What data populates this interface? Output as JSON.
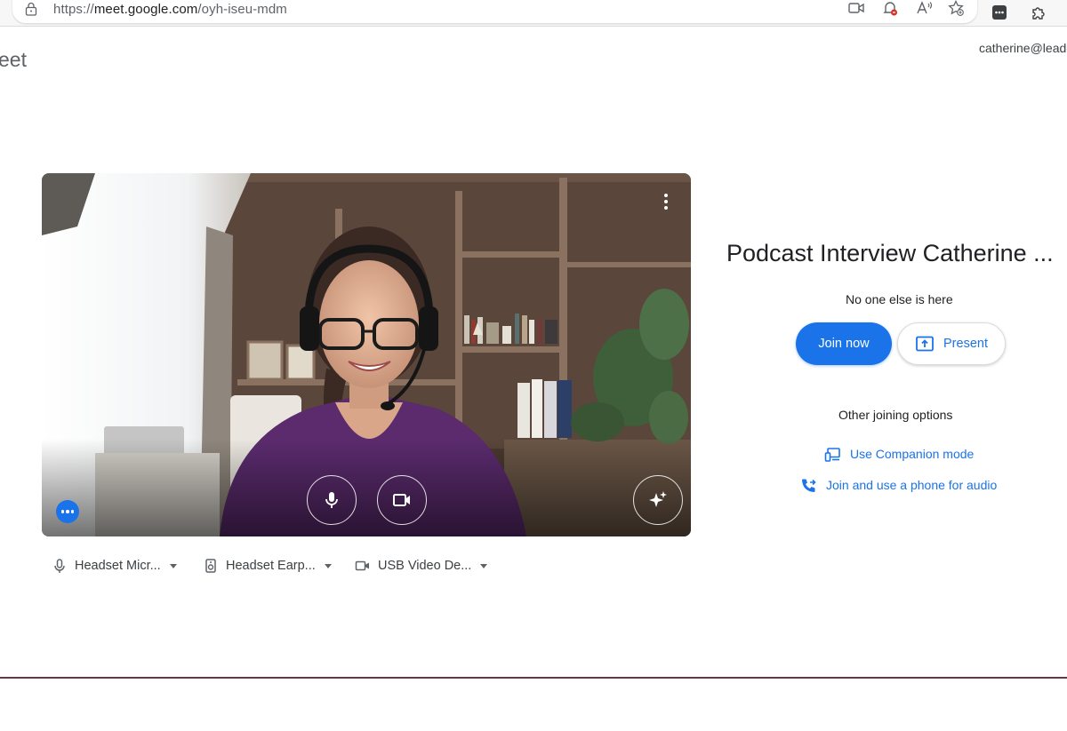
{
  "browser": {
    "url_prefix": "https://",
    "url_host": "meet.google.com",
    "url_path": "/oyh-iseu-mdm",
    "icons": [
      "lock-icon",
      "camera-icon",
      "notification-blocked-icon",
      "read-aloud-icon",
      "favorite-add-icon",
      "extension-menu-icon",
      "puzzle-extensions-icon"
    ]
  },
  "header": {
    "brand": "eet",
    "account": "catherine@leade"
  },
  "preview": {
    "menu_icon": "more-vert-icon",
    "mic_icon": "microphone-icon",
    "camera_icon": "videocam-icon",
    "effects_icon": "sparkle-effects-icon",
    "options_icon": "more-horiz-icon"
  },
  "devices": [
    {
      "icon": "microphone-icon",
      "label": "Headset Micr..."
    },
    {
      "icon": "speaker-icon",
      "label": "Headset Earp..."
    },
    {
      "icon": "videocam-icon",
      "label": "USB Video De..."
    }
  ],
  "panel": {
    "title": "Podcast Interview Catherine ...",
    "status": "No one else is here",
    "join_label": "Join now",
    "present_label": "Present",
    "other_options_title": "Other joining options",
    "companion_label": "Use Companion mode",
    "phone_label": "Join and use a phone for audio"
  },
  "colors": {
    "accent": "#1a73e8",
    "text": "#202124",
    "muted": "#5f6368"
  }
}
